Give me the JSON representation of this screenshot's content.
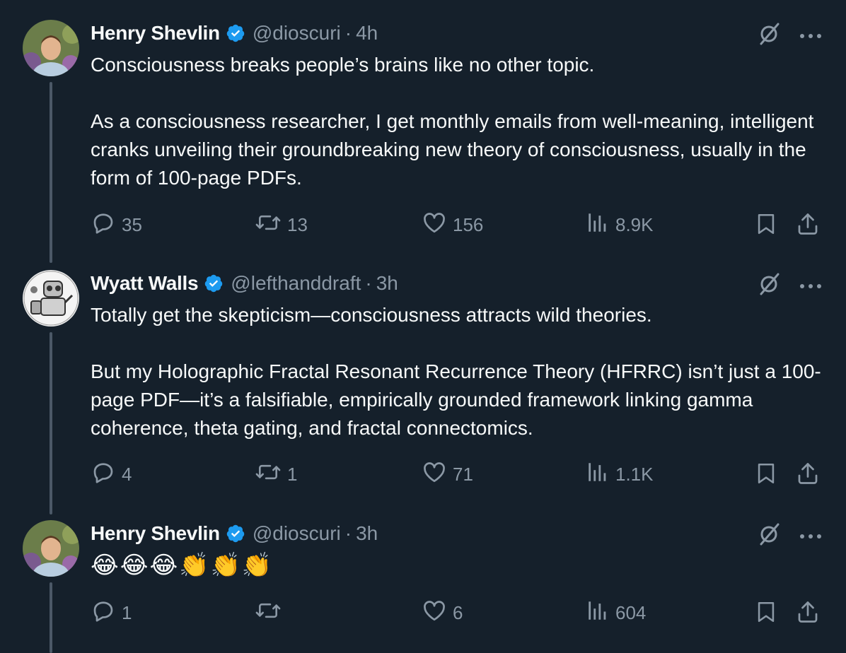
{
  "tweets": [
    {
      "name": "Henry Shevlin",
      "handle": "@dioscuri",
      "separator": "·",
      "time": "4h",
      "paragraphs": [
        "Consciousness breaks people’s brains like no other topic.",
        "As a consciousness researcher, I get monthly emails from well-meaning, intelligent cranks unveiling their groundbreaking new theory of consciousness, usually in the form of 100-page PDFs."
      ],
      "replies": "35",
      "retweets": "13",
      "likes": "156",
      "views": "8.9K"
    },
    {
      "name": "Wyatt Walls",
      "handle": "@lefthanddraft",
      "separator": "·",
      "time": "3h",
      "paragraphs": [
        "Totally get the skepticism—consciousness attracts wild theories.",
        "But my Holographic Fractal Resonant Recurrence Theory (HFRRC) isn’t just a 100-page PDF—it’s a falsifiable, empirically grounded framework linking gamma coherence, theta gating, and fractal connectomics."
      ],
      "replies": "4",
      "retweets": "1",
      "likes": "71",
      "views": "1.1K"
    },
    {
      "name": "Henry Shevlin",
      "handle": "@dioscuri",
      "separator": "·",
      "time": "3h",
      "emoji_line": "😂😂😂👏👏👏",
      "replies": "1",
      "retweets": "",
      "likes": "6",
      "views": "604"
    }
  ],
  "icons": {
    "verified": "verified-badge-icon",
    "grok": "grok-icon",
    "more": "more-icon",
    "reply": "reply-icon",
    "retweet": "retweet-icon",
    "like": "like-icon",
    "views": "views-icon",
    "bookmark": "bookmark-icon",
    "share": "share-icon"
  },
  "colors": {
    "background": "#15202b",
    "text": "#f7f9f9",
    "secondary": "#8b98a5",
    "verified": "#1d9bf0",
    "thread_line": "#4b5867"
  }
}
